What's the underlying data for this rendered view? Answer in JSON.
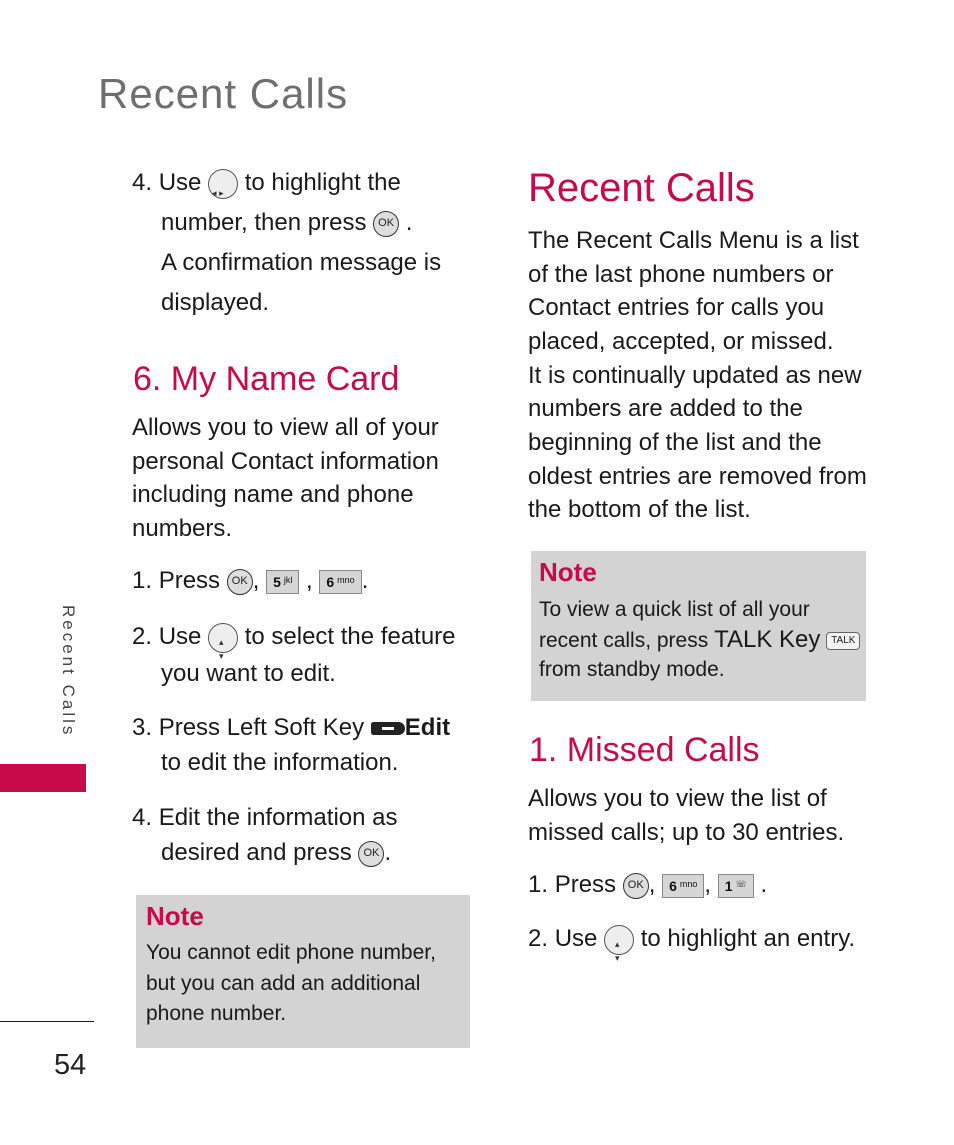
{
  "header": {
    "title": "Recent Calls"
  },
  "sidebar": {
    "section_label": "Recent Calls",
    "accent_color": "#c8094a"
  },
  "footer": {
    "page_number": "54"
  },
  "left_column": {
    "step4_prev": {
      "num": "4.",
      "line1_a": "Use",
      "line1_b": "to highlight the",
      "line2_a": "number, then press",
      "line2_b": ".",
      "line3": "A confirmation message is",
      "line4": "displayed."
    },
    "section": {
      "title": "6. My Name Card",
      "desc_lines": [
        "Allows you to view all of your",
        "personal Contact information",
        "including name and phone",
        "numbers."
      ],
      "step1": {
        "num": "1.",
        "text": "Press",
        "sep1": ",",
        "sep2": ",",
        "end": ".",
        "key5": "5",
        "key5_sub": "jkl",
        "key6": "6",
        "key6_sub": "mno"
      },
      "step2": {
        "num": "2.",
        "a": "Use",
        "b": "to select the feature",
        "line2": "you want to edit."
      },
      "step3": {
        "num": "3.",
        "a": "Press Left Soft Key",
        "softkey_label": "Edit",
        "line2": "to edit the information."
      },
      "step4": {
        "num": "4.",
        "a": "Edit the information as",
        "line2_a": "desired and press",
        "line2_b": "."
      }
    },
    "note": {
      "title": "Note",
      "lines": [
        "You cannot edit phone number,",
        "but you can add an additional",
        "phone number."
      ]
    }
  },
  "right_column": {
    "title": "Recent Calls",
    "desc_lines": [
      "The Recent Calls Menu is a list",
      "of the last phone numbers or",
      "Contact entries for calls you",
      "placed, accepted, or missed.",
      "It is continually updated as new",
      "numbers are added to the",
      "beginning of the list and the",
      "oldest entries are removed from",
      "the bottom of the list."
    ],
    "note": {
      "title": "Note",
      "line1": "To view a quick list of all your",
      "line2_a": "recent calls, press",
      "line2_key": "TALK Key",
      "talk_label": "TALK",
      "line3": "from standby mode."
    },
    "section": {
      "title": "1. Missed Calls",
      "desc_lines": [
        "Allows you to view the list of",
        "missed calls; up to 30 entries."
      ],
      "step1": {
        "num": "1.",
        "text": "Press",
        "sep1": ",",
        "sep2": ",",
        "end": ".",
        "key6": "6",
        "key6_sub": "mno",
        "key1": "1",
        "key1_sub": "☏"
      },
      "step2": {
        "num": "2.",
        "a": "Use",
        "b": "to highlight an entry."
      }
    }
  },
  "icons": {
    "ok_label": "OK"
  }
}
